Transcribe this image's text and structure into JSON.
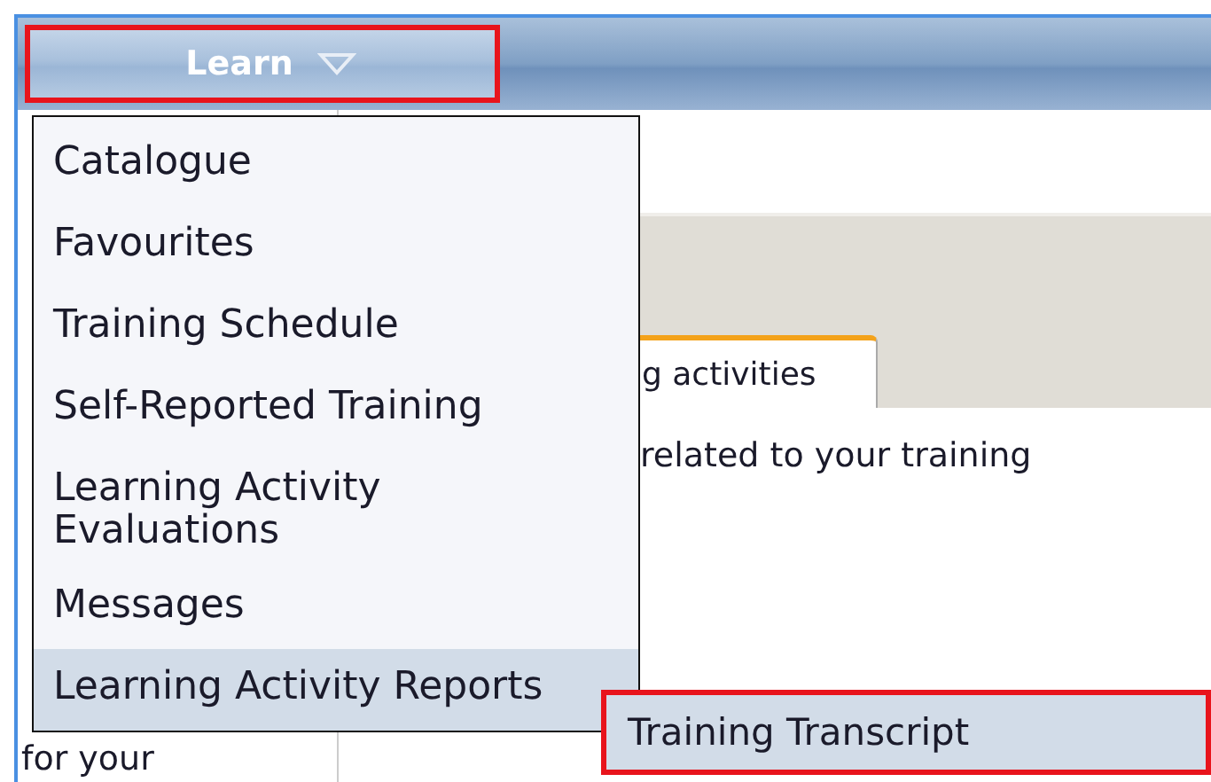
{
  "menu_bar": {
    "button": {
      "label": "Learn",
      "annotated": true
    }
  },
  "page": {
    "tab": {
      "label": "g activities",
      "selected": true
    },
    "text": "related to your training",
    "side_text": "for your"
  },
  "dropdown": {
    "items": [
      {
        "label": "Catalogue",
        "selected": false
      },
      {
        "label": "Favourites",
        "selected": false
      },
      {
        "label": "Training Schedule",
        "selected": false
      },
      {
        "label": "Self-Reported Training",
        "selected": false
      },
      {
        "label": "Learning Activity Evaluations",
        "selected": false
      },
      {
        "label": "Messages",
        "selected": false
      },
      {
        "label": "Learning Activity Reports",
        "selected": true
      }
    ]
  },
  "submenu": {
    "items": [
      {
        "label": "Training Transcript",
        "selected": true,
        "annotated": true
      }
    ]
  }
}
